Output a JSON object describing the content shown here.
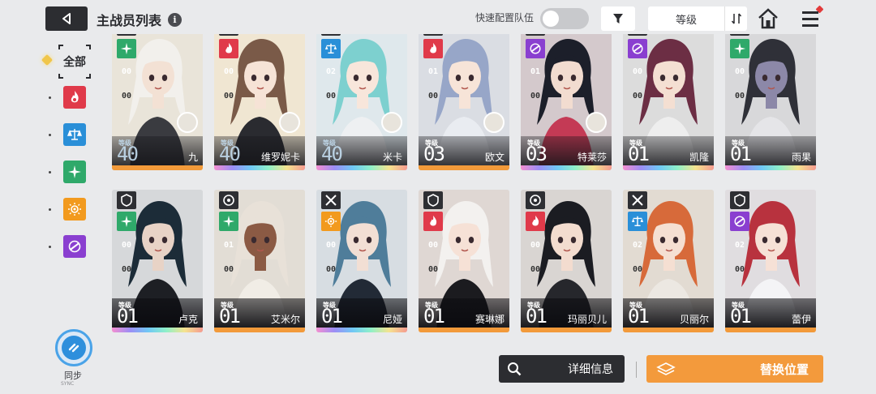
{
  "header": {
    "title": "主战员列表",
    "info_glyph": "i",
    "quick_config_label": "快速配置队伍",
    "quick_config_enabled": false,
    "sort_label": "等级"
  },
  "filters": {
    "all_label": "全部",
    "elements": [
      {
        "name": "fire",
        "color": "#e03a4a"
      },
      {
        "name": "balance",
        "color": "#2a8fd8"
      },
      {
        "name": "wind",
        "color": "#2fa96a"
      },
      {
        "name": "electric",
        "color": "#f29a1e"
      },
      {
        "name": "void",
        "color": "#8a3fd0"
      }
    ]
  },
  "sync": {
    "label": "同步",
    "sub": "SYNC"
  },
  "level_label": "等级",
  "colors": {
    "fire": "#e03a4a",
    "balance": "#2a8fd8",
    "wind": "#2fa96a",
    "electric": "#f29a1e",
    "void": "#8a3fd0",
    "rarity_gold": "#f29a3a",
    "rarity_rainbow": "rainbow"
  },
  "cards_row1": [
    {
      "name": "九",
      "level": "40",
      "element": "wind",
      "stat1": "00",
      "stat2": "00",
      "selected": "gold",
      "rarity": "gold",
      "has_pet": true,
      "faded": true
    },
    {
      "name": "维罗妮卡",
      "level": "40",
      "element": "fire",
      "stat1": "00",
      "stat2": "00",
      "selected": "blue",
      "rarity": "rainbow",
      "has_pet": true,
      "faded": true
    },
    {
      "name": "米卡",
      "level": "40",
      "element": "balance",
      "stat1": "02",
      "stat2": "00",
      "selected": "blue",
      "rarity": "rainbow",
      "has_pet": true,
      "faded": true
    },
    {
      "name": "欧文",
      "level": "03",
      "element": "fire",
      "stat1": "01",
      "stat2": "00",
      "selected": "",
      "rarity": "gold",
      "has_pet": true,
      "faded": false
    },
    {
      "name": "特莱莎",
      "level": "03",
      "element": "void",
      "stat1": "01",
      "stat2": "00",
      "selected": "",
      "rarity": "rainbow",
      "has_pet": true,
      "faded": false
    },
    {
      "name": "凯隆",
      "level": "01",
      "element": "void",
      "stat1": "00",
      "stat2": "00",
      "selected": "",
      "rarity": "rainbow",
      "has_pet": false,
      "faded": false
    },
    {
      "name": "雨果",
      "level": "01",
      "element": "wind",
      "stat1": "00",
      "stat2": "00",
      "selected": "",
      "rarity": "rainbow",
      "has_pet": false,
      "faded": false
    }
  ],
  "cards_row2": [
    {
      "name": "卢克",
      "level": "01",
      "element": "wind",
      "stat1": "00",
      "stat2": "00",
      "rarity": "rainbow"
    },
    {
      "name": "艾米尔",
      "level": "01",
      "element": "wind",
      "stat1": "01",
      "stat2": "00",
      "rarity": "gold"
    },
    {
      "name": "尼娅",
      "level": "01",
      "element": "electric",
      "stat1": "00",
      "stat2": "00",
      "rarity": "rainbow"
    },
    {
      "name": "赛琳娜",
      "level": "01",
      "element": "fire",
      "stat1": "00",
      "stat2": "00",
      "rarity": "gold"
    },
    {
      "name": "玛丽贝儿",
      "level": "01",
      "element": "fire",
      "stat1": "00",
      "stat2": "00",
      "rarity": "gold"
    },
    {
      "name": "贝丽尔",
      "level": "01",
      "element": "balance",
      "stat1": "02",
      "stat2": "00",
      "rarity": "gold"
    },
    {
      "name": "蕾伊",
      "level": "01",
      "element": "void",
      "stat1": "02",
      "stat2": "00",
      "rarity": "gold"
    }
  ],
  "footer": {
    "detail_label": "详细信息",
    "replace_label": "替换位置"
  }
}
